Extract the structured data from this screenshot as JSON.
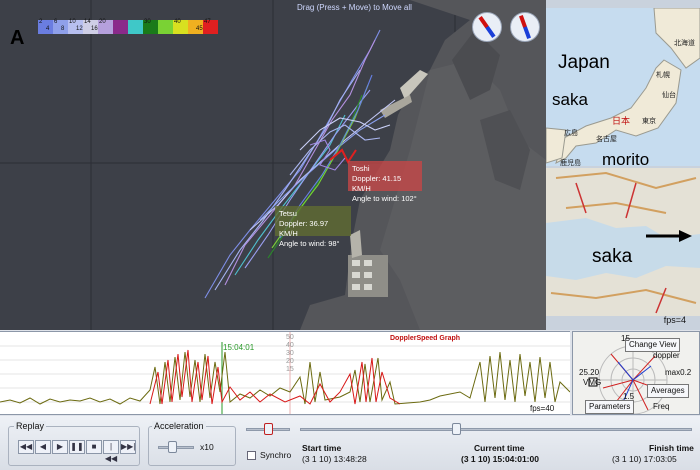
{
  "map": {
    "drag_hint": "Drag (Press + Move) to Move all",
    "north": "A",
    "legend": [
      {
        "color": "#6a7de0",
        "top": "2",
        "bottom": "4"
      },
      {
        "color": "#8fa0ea",
        "top": "6",
        "bottom": "8"
      },
      {
        "color": "#b7bff0",
        "top": "10",
        "bottom": "12"
      },
      {
        "color": "#cfcfe6",
        "top": "14",
        "bottom": "16"
      },
      {
        "color": "#b5a0dc",
        "top": "20",
        "bottom": ""
      },
      {
        "color": "#8a2a8a",
        "top": "",
        "bottom": ""
      },
      {
        "color": "#3fc8c8",
        "top": "",
        "bottom": ""
      },
      {
        "color": "#1a7a1a",
        "top": "30",
        "bottom": ""
      },
      {
        "color": "#7ad234",
        "top": "",
        "bottom": ""
      },
      {
        "color": "#d8e020",
        "top": "40",
        "bottom": ""
      },
      {
        "color": "#f0b020",
        "top": "",
        "bottom": "45"
      },
      {
        "color": "#e02020",
        "top": "47",
        "bottom": ""
      }
    ],
    "toshi": {
      "name": "Toshi",
      "doppler": "Doppler: 41.15 KM/H",
      "angle": "Angle to wind: 102°"
    },
    "tetsu": {
      "name": "Tetsu",
      "doppler": "Doppler: 36.97 KM/H",
      "angle": "Angle to wind: 98°"
    }
  },
  "side": {
    "japan": "Japan",
    "saka1": "saka",
    "morito": "morito",
    "saka2": "saka",
    "fps": "fps=4",
    "cities": [
      "札幌",
      "北海道",
      "仙台",
      "日本",
      "東京",
      "広島",
      "名古屋",
      "鹿児島"
    ]
  },
  "graph": {
    "title": "DopplerSpeed Graph",
    "time_marker": "15:04:01",
    "fps": "fps=40",
    "ticks": [
      "50",
      "40",
      "30",
      "20",
      "15"
    ]
  },
  "radar": {
    "change_view": "Change View",
    "doppler": "doppler",
    "max_label": "max0.2",
    "averages": "Averages",
    "freq": "Freq",
    "params": "Parameters",
    "val": "25.20",
    "vmg": "VMG",
    "deg": "15",
    "misc": "1.5"
  },
  "controls": {
    "replay": "Replay",
    "acceleration": "Acceleration",
    "accel_value": "x10",
    "synchro": "Synchro",
    "start_label": "Start time",
    "start_value": "(3 1 10) 13:48:28",
    "current_label": "Current time",
    "current_value": "(3 1 10) 15:04:01:00",
    "finish_label": "Finish time",
    "finish_value": "(3 1 10) 17:03:05",
    "playback": [
      {
        "name": "rewind-button",
        "glyph": "◀◀"
      },
      {
        "name": "step-back-button",
        "glyph": "◀"
      },
      {
        "name": "play-button",
        "glyph": "▶"
      },
      {
        "name": "pause-button",
        "glyph": "❚❚"
      },
      {
        "name": "stop-button",
        "glyph": "■"
      },
      {
        "name": "skip-back-button",
        "glyph": "|◀◀"
      },
      {
        "name": "skip-forward-button",
        "glyph": "▶▶|"
      }
    ]
  }
}
